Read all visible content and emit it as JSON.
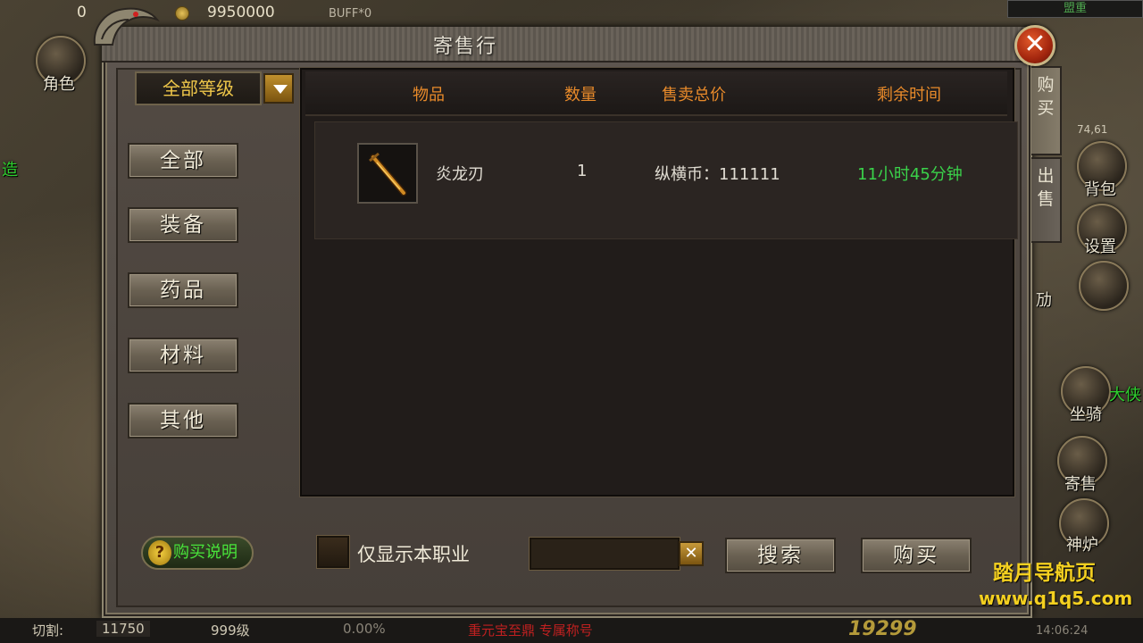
{
  "hud": {
    "top_left_value": "0",
    "gold": "9950000",
    "buff": "BUFF*0",
    "top_right_text": "盟重",
    "left_icon_label": "角色",
    "left_green_text": "造",
    "right_icons": [
      "背包",
      "设置",
      "坐骑",
      "寄售",
      "神炉"
    ],
    "right_partial_texts": [
      "劢",
      "大侠"
    ],
    "minimap_coord": "74,61"
  },
  "window": {
    "title": "寄售行",
    "close_label": "✕"
  },
  "filter": {
    "level_select": "全部等级"
  },
  "categories": [
    "全部",
    "装备",
    "药品",
    "材料",
    "其他"
  ],
  "table": {
    "headers": {
      "item": "物品",
      "qty": "数量",
      "price": "售卖总价",
      "time": "剩余时间"
    },
    "rows": [
      {
        "name": "炎龙刃",
        "qty": "1",
        "price": "纵横币：111111",
        "time": "11小时45分钟",
        "icon": "sword-icon"
      }
    ]
  },
  "controls": {
    "help_label": "购买说明",
    "help_icon": "?",
    "checkbox_label": "仅显示本职业",
    "search_value": "",
    "clear_label": "✕",
    "search_label": "搜索",
    "buy_label": "购买"
  },
  "tabs": {
    "buy": "购买",
    "sell": "出售"
  },
  "bottom": {
    "cut_label": "切割:",
    "cut_value": "11750",
    "level": "999级",
    "exp": "0.00%",
    "notice": "重元宝至鼎 专属称号",
    "power": "19299",
    "time": "14:06:24"
  },
  "watermark": {
    "line1": "踏月导航页",
    "line2": "www.q1q5.com"
  }
}
